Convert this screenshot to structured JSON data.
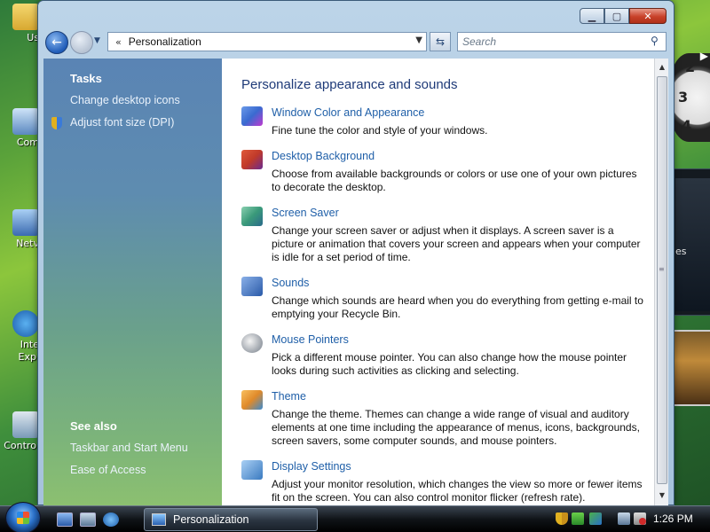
{
  "desktop": {
    "icons": [
      {
        "label": "Us"
      },
      {
        "label": "Com"
      },
      {
        "label": "Netv"
      },
      {
        "label": "Inte Expl"
      },
      {
        "label": "Control"
      }
    ],
    "gadget_text": "es"
  },
  "window": {
    "title_buttons": {
      "minimize": "▁",
      "maximize": "▢",
      "close": "✕"
    },
    "address": {
      "chevron": "«",
      "crumb": "Personalization"
    },
    "search_placeholder": "Search"
  },
  "task_pane": {
    "tasks_title": "Tasks",
    "tasks": [
      "Change desktop icons",
      "Adjust font size (DPI)"
    ],
    "see_also_title": "See also",
    "see_also": [
      "Taskbar and Start Menu",
      "Ease of Access"
    ]
  },
  "content": {
    "heading": "Personalize appearance and sounds",
    "items": [
      {
        "title": "Window Color and Appearance",
        "desc": "Fine tune the color and style of your windows.",
        "icon": "window-color-icon",
        "color": "#3a6ad0"
      },
      {
        "title": "Desktop Background",
        "desc": "Choose from available backgrounds or colors or use one of your own pictures to decorate the desktop.",
        "icon": "desktop-background-icon",
        "color": "#c03a2a"
      },
      {
        "title": "Screen Saver",
        "desc": "Change your screen saver or adjust when it displays. A screen saver is a picture or animation that covers your screen and appears when your computer is idle for a set period of time.",
        "icon": "screen-saver-icon",
        "color": "#3a9a7a"
      },
      {
        "title": "Sounds",
        "desc": "Change which sounds are heard when you do everything from getting e-mail to emptying your Recycle Bin.",
        "icon": "sounds-icon",
        "color": "#2a5aa8"
      },
      {
        "title": "Mouse Pointers",
        "desc": "Pick a different mouse pointer. You can also change how the mouse pointer looks during such activities as clicking and selecting.",
        "icon": "mouse-pointers-icon",
        "color": "#9aa0a8"
      },
      {
        "title": "Theme",
        "desc": "Change the theme. Themes can change a wide range of visual and auditory elements at one time including the appearance of menus, icons, backgrounds, screen savers, some computer sounds, and mouse pointers.",
        "icon": "theme-icon",
        "color": "#e08a2a"
      },
      {
        "title": "Display Settings",
        "desc": "Adjust your monitor resolution, which changes the view so more or fewer items fit on the screen. You can also control monitor flicker (refresh rate).",
        "icon": "display-settings-icon",
        "color": "#3a7ac0"
      }
    ]
  },
  "taskbar": {
    "active_window": "Personalization",
    "clock": "1:26 PM"
  },
  "colors": {
    "link": "#1f5fa8",
    "heading": "#1e3a78"
  }
}
